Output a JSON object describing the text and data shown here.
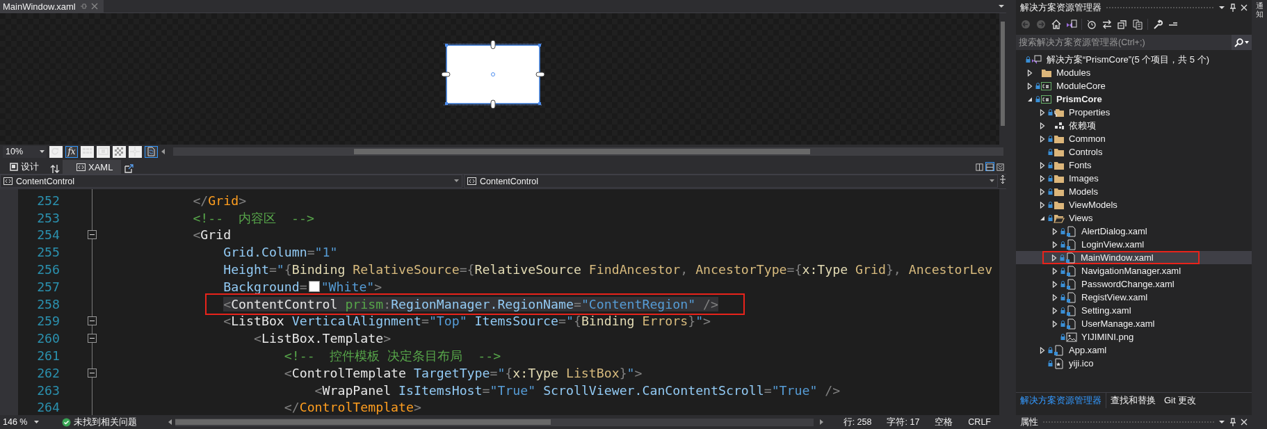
{
  "document_tab": {
    "title": "MainWindow.xaml",
    "selected": true
  },
  "designer": {
    "zoom": "10%",
    "tools": [
      {
        "kind": "refresh",
        "on": false
      },
      {
        "kind": "formula",
        "label": "fx",
        "on": true
      },
      {
        "kind": "grid",
        "on": false
      },
      {
        "kind": "snap",
        "on": false
      },
      {
        "kind": "checker",
        "on": false
      },
      {
        "kind": "crosshair",
        "on": false
      },
      {
        "kind": "sync",
        "on": true
      }
    ]
  },
  "view_tabs": [
    {
      "label": "设计",
      "kind": "design",
      "selected": false
    },
    {
      "label": "XAML",
      "kind": "xaml",
      "selected": true
    }
  ],
  "split_buttons": [
    {
      "kind": "vertical",
      "selected": false
    },
    {
      "kind": "horizontal",
      "selected": true
    },
    {
      "kind": "collapse",
      "selected": false
    }
  ],
  "navigation": {
    "left": "ContentControl",
    "right": "ContentControl"
  },
  "code": {
    "lines": [
      {
        "number": "252",
        "fold_marker": false,
        "highlighted": false,
        "annotated": false,
        "tokens": [
          {
            "kind": "p",
            "text": "            </"
          },
          {
            "kind": "tagc",
            "text": "Grid"
          },
          {
            "kind": "p",
            "text": ">"
          }
        ]
      },
      {
        "number": "253",
        "fold_marker": false,
        "highlighted": false,
        "annotated": false,
        "tokens": [
          {
            "kind": "comment",
            "text": "            <!--  内容区  -->"
          }
        ]
      },
      {
        "number": "254",
        "fold_marker": true,
        "highlighted": false,
        "annotated": false,
        "tokens": [
          {
            "kind": "p",
            "text": "            <"
          },
          {
            "kind": "tag",
            "text": "Grid"
          }
        ]
      },
      {
        "number": "255",
        "fold_marker": false,
        "highlighted": false,
        "annotated": false,
        "tokens": [
          {
            "kind": "attr",
            "text": "                Grid.Column"
          },
          {
            "kind": "p",
            "text": "="
          },
          {
            "kind": "str",
            "text": "\"1\""
          }
        ]
      },
      {
        "number": "256",
        "fold_marker": false,
        "highlighted": false,
        "annotated": false,
        "tokens": [
          {
            "kind": "attr",
            "text": "                Height"
          },
          {
            "kind": "p",
            "text": "="
          },
          {
            "kind": "str",
            "text": "\""
          },
          {
            "kind": "p",
            "text": "{"
          },
          {
            "kind": "ext",
            "text": "Binding"
          },
          {
            "kind": "extattr",
            "text": " RelativeSource"
          },
          {
            "kind": "p",
            "text": "={"
          },
          {
            "kind": "ext",
            "text": "RelativeSource"
          },
          {
            "kind": "extattr",
            "text": " FindAncestor"
          },
          {
            "kind": "p",
            "text": ","
          },
          {
            "kind": "extattr",
            "text": " AncestorType"
          },
          {
            "kind": "p",
            "text": "={"
          },
          {
            "kind": "ext",
            "text": "x:Type"
          },
          {
            "kind": "extattr",
            "text": " Grid"
          },
          {
            "kind": "p",
            "text": "},"
          },
          {
            "kind": "extattr",
            "text": " AncestorLev"
          }
        ]
      },
      {
        "number": "257",
        "fold_marker": false,
        "highlighted": false,
        "annotated": false,
        "tokens": [
          {
            "kind": "attr",
            "text": "                Background"
          },
          {
            "kind": "p",
            "text": "="
          },
          {
            "kind": "swatch",
            "color": "#ffffff"
          },
          {
            "kind": "str",
            "text": "\"White\""
          },
          {
            "kind": "p",
            "text": ">"
          }
        ]
      },
      {
        "number": "258",
        "fold_marker": false,
        "highlighted": true,
        "annotated": true,
        "tokens": [
          {
            "kind": "p",
            "text": "                <"
          },
          {
            "kind": "tag",
            "text": "ContentControl"
          },
          {
            "kind": "ns",
            "text": " prism"
          },
          {
            "kind": "p",
            "text": ":"
          },
          {
            "kind": "attr",
            "text": "RegionManager.RegionName"
          },
          {
            "kind": "p",
            "text": "="
          },
          {
            "kind": "str",
            "text": "\"ContentRegion\""
          },
          {
            "kind": "p",
            "text": " />"
          }
        ]
      },
      {
        "number": "259",
        "fold_marker": true,
        "highlighted": false,
        "annotated": false,
        "tokens": [
          {
            "kind": "p",
            "text": "                <"
          },
          {
            "kind": "tag",
            "text": "ListBox"
          },
          {
            "kind": "attr",
            "text": " VerticalAlignment"
          },
          {
            "kind": "p",
            "text": "="
          },
          {
            "kind": "str",
            "text": "\"Top\""
          },
          {
            "kind": "attr",
            "text": " ItemsSource"
          },
          {
            "kind": "p",
            "text": "="
          },
          {
            "kind": "str",
            "text": "\""
          },
          {
            "kind": "p",
            "text": "{"
          },
          {
            "kind": "ext",
            "text": "Binding"
          },
          {
            "kind": "extattr",
            "text": " Errors"
          },
          {
            "kind": "p",
            "text": "}"
          },
          {
            "kind": "str",
            "text": "\""
          },
          {
            "kind": "p",
            "text": ">"
          }
        ]
      },
      {
        "number": "260",
        "fold_marker": true,
        "highlighted": false,
        "annotated": false,
        "tokens": [
          {
            "kind": "p",
            "text": "                    <"
          },
          {
            "kind": "tag",
            "text": "ListBox.Template"
          },
          {
            "kind": "p",
            "text": ">"
          }
        ]
      },
      {
        "number": "261",
        "fold_marker": false,
        "highlighted": false,
        "annotated": false,
        "tokens": [
          {
            "kind": "comment",
            "text": "                        <!--  控件模板 决定条目布局  -->"
          }
        ]
      },
      {
        "number": "262",
        "fold_marker": true,
        "highlighted": false,
        "annotated": false,
        "tokens": [
          {
            "kind": "p",
            "text": "                        <"
          },
          {
            "kind": "tag",
            "text": "ControlTemplate"
          },
          {
            "kind": "attr",
            "text": " TargetType"
          },
          {
            "kind": "p",
            "text": "="
          },
          {
            "kind": "str",
            "text": "\""
          },
          {
            "kind": "p",
            "text": "{"
          },
          {
            "kind": "ext",
            "text": "x:Type"
          },
          {
            "kind": "extattr",
            "text": " ListBox"
          },
          {
            "kind": "p",
            "text": "}"
          },
          {
            "kind": "str",
            "text": "\""
          },
          {
            "kind": "p",
            "text": ">"
          }
        ]
      },
      {
        "number": "263",
        "fold_marker": false,
        "highlighted": false,
        "annotated": false,
        "tokens": [
          {
            "kind": "p",
            "text": "                            <"
          },
          {
            "kind": "tag",
            "text": "WrapPanel"
          },
          {
            "kind": "attr",
            "text": " IsItemsHost"
          },
          {
            "kind": "p",
            "text": "="
          },
          {
            "kind": "str",
            "text": "\"True\""
          },
          {
            "kind": "attr",
            "text": " ScrollViewer.CanContentScroll"
          },
          {
            "kind": "p",
            "text": "="
          },
          {
            "kind": "str",
            "text": "\"True\""
          },
          {
            "kind": "p",
            "text": " />"
          }
        ]
      },
      {
        "number": "264",
        "fold_marker": false,
        "highlighted": false,
        "annotated": false,
        "tokens": [
          {
            "kind": "p",
            "text": "                        </"
          },
          {
            "kind": "tagc",
            "text": "ControlTemplate"
          },
          {
            "kind": "p",
            "text": ">"
          }
        ]
      }
    ]
  },
  "status_bar": {
    "zoom": "146 %",
    "issues": "未找到相关问题",
    "line": "行: 258",
    "column": "字符: 17",
    "indent": "空格",
    "line_ending": "CRLF"
  },
  "solution_explorer": {
    "title": "解决方案资源管理器",
    "search": {
      "placeholder": "搜索解决方案资源管理器(Ctrl+;)"
    },
    "tree": [
      {
        "label": "解决方案“PrismCore”(5 个项目，共 5 个)",
        "kind": "solution",
        "locked": true,
        "selected": false,
        "annotated": false,
        "children": [
          {
            "label": "Modules",
            "kind": "folder",
            "expanded": false,
            "locked": false,
            "selected": false,
            "annotated": false
          },
          {
            "label": "ModuleCore",
            "kind": "project",
            "startup": false,
            "expanded": false,
            "locked": true,
            "selected": false,
            "annotated": false
          },
          {
            "label": "PrismCore",
            "kind": "project",
            "startup": true,
            "expanded": true,
            "locked": true,
            "selected": false,
            "annotated": false,
            "children": [
              {
                "label": "Properties",
                "kind": "properties",
                "expanded": false,
                "locked": true,
                "selected": false,
                "annotated": false
              },
              {
                "label": "依赖项",
                "kind": "dependencies",
                "expanded": false,
                "locked": false,
                "selected": false,
                "annotated": false
              },
              {
                "label": "Common",
                "kind": "folder",
                "expanded": false,
                "locked": true,
                "selected": false,
                "annotated": false
              },
              {
                "label": "Controls",
                "kind": "folder",
                "locked": true,
                "selected": false,
                "annotated": false
              },
              {
                "label": "Fonts",
                "kind": "folder",
                "expanded": false,
                "locked": true,
                "selected": false,
                "annotated": false
              },
              {
                "label": "Images",
                "kind": "folder",
                "expanded": false,
                "locked": true,
                "selected": false,
                "annotated": false
              },
              {
                "label": "Models",
                "kind": "folder",
                "expanded": false,
                "locked": true,
                "selected": false,
                "annotated": false
              },
              {
                "label": "ViewModels",
                "kind": "folder",
                "expanded": false,
                "locked": true,
                "selected": false,
                "annotated": false
              },
              {
                "label": "Views",
                "kind": "folder",
                "expanded": true,
                "locked": true,
                "selected": false,
                "annotated": false,
                "children": [
                  {
                    "label": "AlertDialog.xaml",
                    "kind": "xaml",
                    "expanded": false,
                    "locked": true,
                    "selected": false,
                    "annotated": false
                  },
                  {
                    "label": "LoginView.xaml",
                    "kind": "xaml",
                    "expanded": false,
                    "locked": true,
                    "selected": false,
                    "annotated": false
                  },
                  {
                    "label": "MainWindow.xaml",
                    "kind": "xaml",
                    "expanded": false,
                    "locked": true,
                    "selected": true,
                    "annotated": true
                  },
                  {
                    "label": "NavigationManager.xaml",
                    "kind": "xaml",
                    "expanded": false,
                    "locked": true,
                    "selected": false,
                    "annotated": false
                  },
                  {
                    "label": "PasswordChange.xaml",
                    "kind": "xaml",
                    "expanded": false,
                    "locked": true,
                    "selected": false,
                    "annotated": false
                  },
                  {
                    "label": "RegistView.xaml",
                    "kind": "xaml",
                    "expanded": false,
                    "locked": true,
                    "selected": false,
                    "annotated": false
                  },
                  {
                    "label": "Setting.xaml",
                    "kind": "xaml",
                    "expanded": false,
                    "locked": true,
                    "selected": false,
                    "annotated": false
                  },
                  {
                    "label": "UserManage.xaml",
                    "kind": "xaml",
                    "expanded": false,
                    "locked": true,
                    "selected": false,
                    "annotated": false
                  },
                  {
                    "label": "YIJIMINI.png",
                    "kind": "image",
                    "locked": true,
                    "selected": false,
                    "annotated": false
                  }
                ]
              },
              {
                "label": "App.xaml",
                "kind": "xaml",
                "expanded": false,
                "locked": true,
                "selected": false,
                "annotated": false
              },
              {
                "label": "yiji.ico",
                "kind": "icofile",
                "locked": true,
                "selected": false,
                "annotated": false
              }
            ]
          }
        ]
      }
    ],
    "tabs": [
      {
        "label": "解决方案资源管理器",
        "selected": true
      },
      {
        "label": "查找和替换",
        "selected": false
      },
      {
        "label": "Git 更改",
        "selected": false
      }
    ]
  },
  "properties_panel": {
    "title": "属性"
  },
  "notifications_tab": {
    "label": "通知"
  }
}
